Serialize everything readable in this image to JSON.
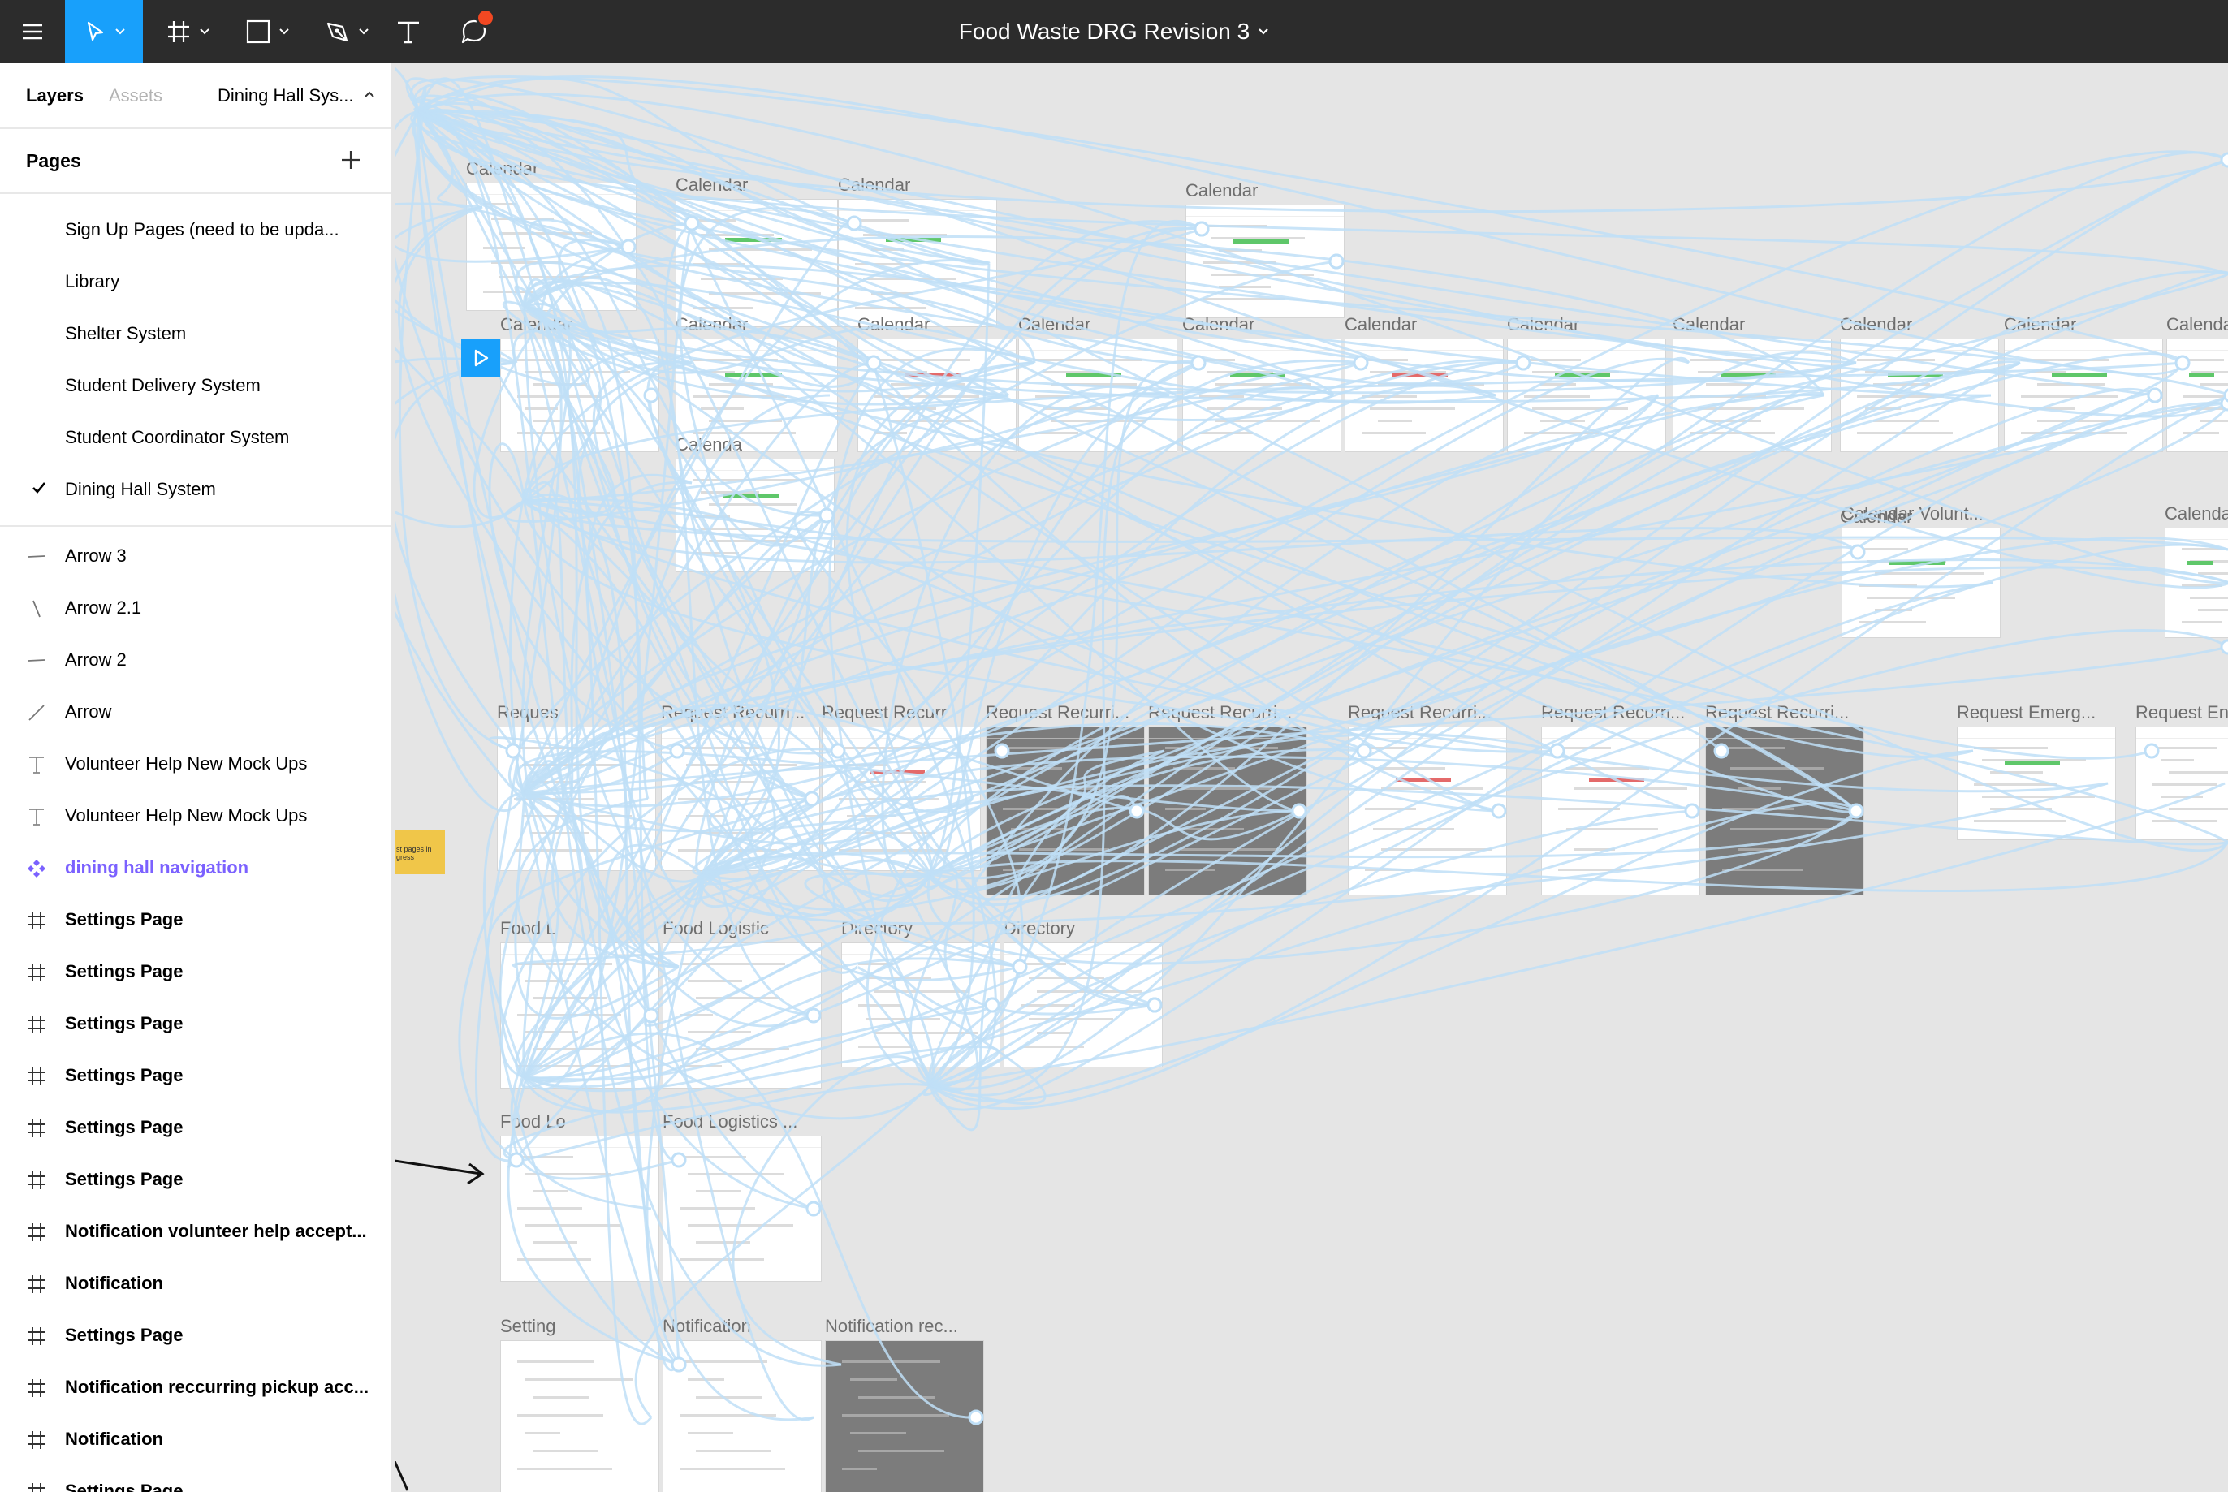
{
  "toolbar": {
    "document_title": "Food Waste DRG Revision 3",
    "tools": [
      "menu-icon",
      "move-tool",
      "frame-tool",
      "shape-tool",
      "pen-tool",
      "text-tool",
      "comment-tool"
    ]
  },
  "sidebar": {
    "tabs": {
      "layers": "Layers",
      "assets": "Assets"
    },
    "current_page_short": "Dining Hall Sys...",
    "pages_header": "Pages",
    "pages": [
      {
        "label": "Sign Up Pages (need to be upda..."
      },
      {
        "label": "Library"
      },
      {
        "label": "Shelter System"
      },
      {
        "label": "Student Delivery System"
      },
      {
        "label": "Student Coordinator System"
      },
      {
        "label": "Dining Hall System",
        "current": true
      }
    ],
    "layers": [
      {
        "label": "Arrow 3",
        "type": "line-flat"
      },
      {
        "label": "Arrow 2.1",
        "type": "line-steep"
      },
      {
        "label": "Arrow 2",
        "type": "line-flat"
      },
      {
        "label": "Arrow",
        "type": "line-diag"
      },
      {
        "label": "Volunteer Help New Mock Ups",
        "type": "text"
      },
      {
        "label": "Volunteer Help New Mock Ups",
        "type": "text"
      },
      {
        "label": "dining hall navigation",
        "type": "component"
      },
      {
        "label": "Settings Page",
        "type": "frame"
      },
      {
        "label": "Settings Page",
        "type": "frame"
      },
      {
        "label": "Settings Page",
        "type": "frame"
      },
      {
        "label": "Settings Page",
        "type": "frame"
      },
      {
        "label": "Settings Page",
        "type": "frame"
      },
      {
        "label": "Settings Page",
        "type": "frame"
      },
      {
        "label": "Notification volunteer help accept...",
        "type": "frame"
      },
      {
        "label": "Notification",
        "type": "frame"
      },
      {
        "label": "Settings Page",
        "type": "frame"
      },
      {
        "label": "Notification reccurring pickup acc...",
        "type": "frame"
      },
      {
        "label": "Notification",
        "type": "frame"
      },
      {
        "label": "Settings Page",
        "type": "frame"
      }
    ]
  },
  "canvas": {
    "sticky_note": "st pages in\ngress",
    "frames": [
      {
        "label": "Calendar"
      },
      {
        "label": "Calendar"
      },
      {
        "label": "Calendar"
      },
      {
        "label": "Calendar"
      },
      {
        "label": "Calendar"
      },
      {
        "label": "Calendar"
      },
      {
        "label": "Calendar"
      },
      {
        "label": "Calendar"
      },
      {
        "label": "Calendar"
      },
      {
        "label": "Calendar"
      },
      {
        "label": "Calendar"
      },
      {
        "label": "Calendar"
      },
      {
        "label": "Calendar"
      },
      {
        "label": "Calendar"
      },
      {
        "label": "Calendar"
      },
      {
        "label": "Calenda"
      },
      {
        "label": "Calendar"
      },
      {
        "label": "Calendar Volunt..."
      },
      {
        "label": "Calenda"
      },
      {
        "label": "Reques"
      },
      {
        "label": "Request Recurri..."
      },
      {
        "label": "Request Recurr"
      },
      {
        "label": "Request Recurri..."
      },
      {
        "label": "Request Recurri..."
      },
      {
        "label": "Request Recurri..."
      },
      {
        "label": "Request Recurri..."
      },
      {
        "label": "Request Recurri..."
      },
      {
        "label": "Request Emerg..."
      },
      {
        "label": "Request En"
      },
      {
        "label": "Food L"
      },
      {
        "label": "Food Logistic"
      },
      {
        "label": "Directory"
      },
      {
        "label": "Directory"
      },
      {
        "label": "Food Lo"
      },
      {
        "label": "Food Logistics ..."
      },
      {
        "label": "Setting"
      },
      {
        "label": "Notification"
      },
      {
        "label": "Notification rec..."
      }
    ]
  },
  "colors": {
    "accent": "#18a0fb",
    "toolbar_bg": "#2c2c2c",
    "wire": "#bfdff7",
    "component": "#7b61ff",
    "notification_dot": "#f24822"
  }
}
